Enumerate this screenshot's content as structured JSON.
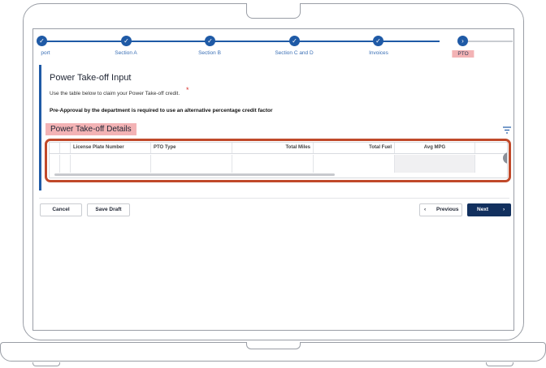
{
  "stepper": {
    "steps": [
      {
        "label": "port",
        "icon": "check-icon",
        "done": true
      },
      {
        "label": "Section A",
        "icon": "check-icon",
        "done": true
      },
      {
        "label": "Section B",
        "icon": "check-icon",
        "done": true
      },
      {
        "label": "Section C and D",
        "icon": "check-icon",
        "done": true
      },
      {
        "label": "Invoices",
        "icon": "check-icon",
        "done": true
      },
      {
        "label": "PTO",
        "icon": "chevron-right-icon",
        "active": true
      }
    ]
  },
  "page": {
    "title": "Power Take-off Input",
    "required_mark": "*",
    "description": "Use the table below to claim your Power Take-off credit.",
    "note": "Pre-Approval by the department is required to use an alternative percentage credit factor",
    "section_title": "Power Take-off Details"
  },
  "grid": {
    "columns": [
      "",
      "",
      "License Plate Number",
      "PTO Type",
      "Total Miles",
      "Total Fuel",
      "Avg MPG"
    ]
  },
  "footer": {
    "cancel": "Cancel",
    "save_draft": "Save Draft",
    "previous": "Previous",
    "next": "Next",
    "prev_icon": "‹",
    "next_icon": "›"
  },
  "colors": {
    "brand": "#1f5aa6",
    "highlight": "#f3b3b5",
    "annotation": "#c0492a",
    "primary_button": "#12305e"
  }
}
